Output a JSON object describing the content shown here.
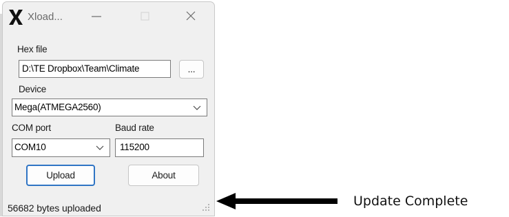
{
  "window": {
    "title": "Xload...",
    "icon": "x-logo-icon",
    "controls": {
      "minimize": "minimize-icon",
      "maximize": "maximize-icon",
      "close": "close-icon"
    }
  },
  "form": {
    "hex_file_label": "Hex file",
    "hex_file_value": "D:\\TE Dropbox\\Team\\Climate",
    "browse_label": "...",
    "device_label": "Device",
    "device_value": "Mega(ATMEGA2560)",
    "com_port_label": "COM port",
    "com_port_value": "COM10",
    "baud_rate_label": "Baud rate",
    "baud_rate_value": "115200"
  },
  "buttons": {
    "upload": "Upload",
    "about": "About"
  },
  "status": {
    "text": "56682 bytes uploaded"
  },
  "annotation": {
    "text": "Update Complete"
  },
  "colors": {
    "focus_border": "#2f74c4",
    "window_bg": "#f0f0f0",
    "arrow": "#000000"
  }
}
